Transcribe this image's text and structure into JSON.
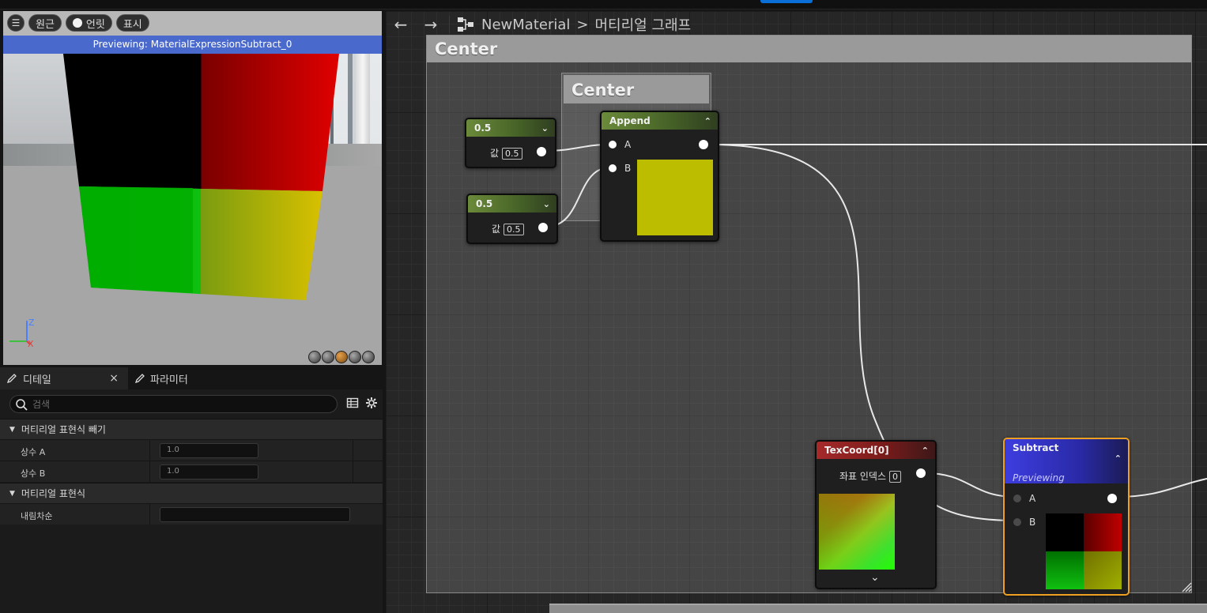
{
  "viewport": {
    "toolbar": {
      "menu_icon": "hamburger-icon",
      "perspective_label": "원근",
      "lit_label": "언릿",
      "show_label": "표시"
    },
    "preview_banner": "Previewing: MaterialExpressionSubtract_0",
    "axis_z": "Z",
    "axis_x": "X",
    "preview_shapes": [
      "cylinder-preview-icon",
      "sphere-preview-icon",
      "plane-preview-icon",
      "cube-preview-icon",
      "custom-mesh-preview-icon"
    ],
    "active_shape_index": 2
  },
  "details": {
    "tabs": [
      {
        "label": "디테일",
        "icon": "pencil-icon",
        "closable": true
      },
      {
        "label": "파라미터",
        "icon": "pencil-icon",
        "closable": false
      }
    ],
    "close_glyph": "×",
    "search_placeholder": "검색",
    "categories": [
      {
        "label": "머티리얼 표현식 빼기",
        "rows": [
          {
            "label": "상수 A",
            "value": "1.0"
          },
          {
            "label": "상수 B",
            "value": "1.0"
          }
        ]
      },
      {
        "label": "머티리얼 표현식",
        "rows": [
          {
            "label": "내림차순",
            "value": ""
          }
        ]
      }
    ]
  },
  "graph": {
    "breadcrumb": {
      "asset": "NewMaterial",
      "separator": ">",
      "graph": "머티리얼 그래프"
    },
    "comments": {
      "outer": "Center",
      "inner": "Center"
    },
    "nodes": {
      "const1": {
        "title": "0.5",
        "value_label": "값",
        "value": "0.5"
      },
      "const2": {
        "title": "0.5",
        "value_label": "값",
        "value": "0.5"
      },
      "append": {
        "title": "Append",
        "pin_a": "A",
        "pin_b": "B",
        "preview_color": "#bdbd00"
      },
      "texcoord": {
        "title": "TexCoord[0]",
        "index_label": "좌표 인덱스",
        "index_value": "0"
      },
      "subtract": {
        "title": "Subtract",
        "subtitle": "Previewing",
        "pin_a": "A",
        "pin_b": "B"
      }
    }
  }
}
